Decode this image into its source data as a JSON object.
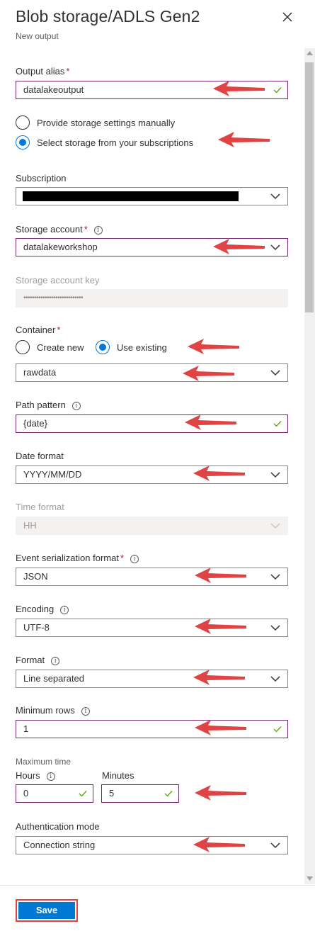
{
  "header": {
    "title": "Blob storage/ADLS Gen2",
    "subtitle": "New output"
  },
  "output_alias": {
    "label": "Output alias",
    "required": "*",
    "value": "datalakeoutput"
  },
  "storage_mode": {
    "manual_label": "Provide storage settings manually",
    "subscription_label": "Select storage from your subscriptions",
    "selected": "subscription"
  },
  "subscription": {
    "label": "Subscription"
  },
  "storage_account": {
    "label": "Storage account",
    "required": "*",
    "value": "datalakeworkshop"
  },
  "storage_account_key": {
    "label": "Storage account key",
    "value": "••••••••••••••••••••••••••••"
  },
  "container": {
    "label": "Container",
    "required": "*",
    "create_new_label": "Create new",
    "use_existing_label": "Use existing",
    "selected": "use_existing",
    "value": "rawdata"
  },
  "path_pattern": {
    "label": "Path pattern",
    "value": "{date}"
  },
  "date_format": {
    "label": "Date format",
    "value": "YYYY/MM/DD"
  },
  "time_format": {
    "label": "Time format",
    "value": "HH"
  },
  "event_serialization": {
    "label": "Event serialization format",
    "required": "*",
    "value": "JSON"
  },
  "encoding": {
    "label": "Encoding",
    "value": "UTF-8"
  },
  "format": {
    "label": "Format",
    "value": "Line separated"
  },
  "minimum_rows": {
    "label": "Minimum rows",
    "value": "1"
  },
  "maximum_time": {
    "label": "Maximum time",
    "hours_label": "Hours",
    "hours_value": "0",
    "minutes_label": "Minutes",
    "minutes_value": "5"
  },
  "authentication_mode": {
    "label": "Authentication mode",
    "value": "Connection string"
  },
  "footer": {
    "save_label": "Save"
  },
  "colors": {
    "accent": "#0078d4",
    "valid_border": "#742774",
    "valid_check": "#57a300",
    "arrow": "#e04343",
    "required": "#a4262c"
  },
  "icons": [
    "close-icon",
    "chevron-down-icon",
    "checkmark-icon",
    "info-icon",
    "red-arrow-icon"
  ]
}
